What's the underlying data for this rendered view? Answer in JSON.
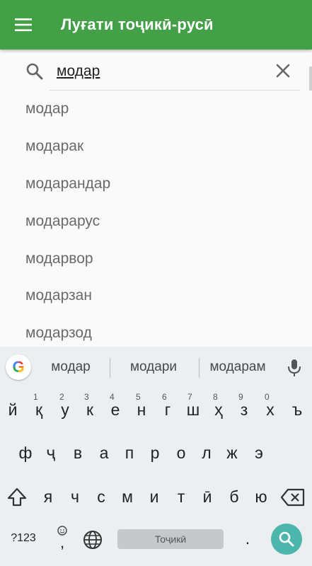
{
  "appbar": {
    "title": "Луғати тоҷикӣ-русӣ",
    "menu_icon": "hamburger-icon"
  },
  "search": {
    "value": "модар",
    "search_icon": "search-icon",
    "clear_icon": "close-icon"
  },
  "suggestions": [
    "модар",
    "модарак",
    "модарандар",
    "модарарус",
    "модарвор",
    "модарзан",
    "модарзод"
  ],
  "keyboard": {
    "suggestions": [
      "модар",
      "модари",
      "модарам"
    ],
    "row1": [
      "й",
      "қ",
      "у",
      "к",
      "е",
      "н",
      "г",
      "ш",
      "ҳ",
      "з",
      "х",
      "ъ"
    ],
    "row1_hints": [
      "1",
      "2",
      "3",
      "4",
      "5",
      "6",
      "7",
      "8",
      "9",
      "0"
    ],
    "row2": [
      "ф",
      "ҷ",
      "в",
      "а",
      "п",
      "р",
      "о",
      "л",
      "ж",
      "э"
    ],
    "row3": [
      "я",
      "ч",
      "с",
      "м",
      "и",
      "т",
      "ӣ",
      "б",
      "ю"
    ],
    "symbols_label": "?123",
    "comma_label": ",",
    "space_label": "Тоҷикӣ",
    "period_label": ".",
    "brand_letter": "G"
  },
  "colors": {
    "appbar": "#43a047",
    "accent_go": "#4db6ac"
  }
}
